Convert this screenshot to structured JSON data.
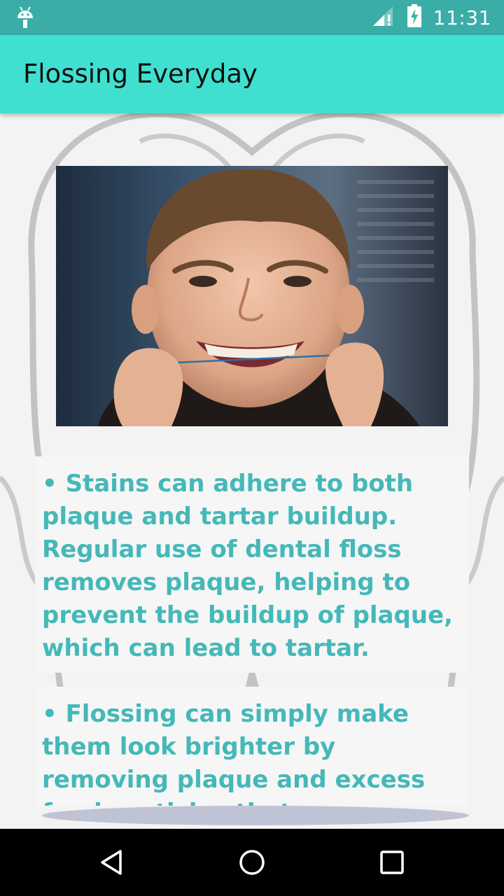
{
  "status_bar": {
    "time": "11:31",
    "left_icon": "android-debug-icon",
    "right_icons": [
      "signal-icon",
      "battery-charging-icon"
    ]
  },
  "app_bar": {
    "title": "Flossing Everyday"
  },
  "content": {
    "photo": {
      "icon": "child-flossing-photo"
    },
    "cards": [
      {
        "text": "• Stains can adhere to both plaque and tartar buildup. Regular use of dental floss removes plaque, helping to prevent the buildup of plaque, which can lead to tartar."
      },
      {
        "text": "• Flossing can simply make them look brighter by removing plaque and excess food particles that cause stains on the enamel."
      }
    ]
  },
  "nav_bar": {
    "icons": [
      "back-icon",
      "home-icon",
      "recent-apps-icon"
    ]
  },
  "colors": {
    "status_bar": "#3aada6",
    "app_bar": "#40e0d0",
    "card_text": "#45b8b8",
    "background": "#f3f3f3"
  }
}
